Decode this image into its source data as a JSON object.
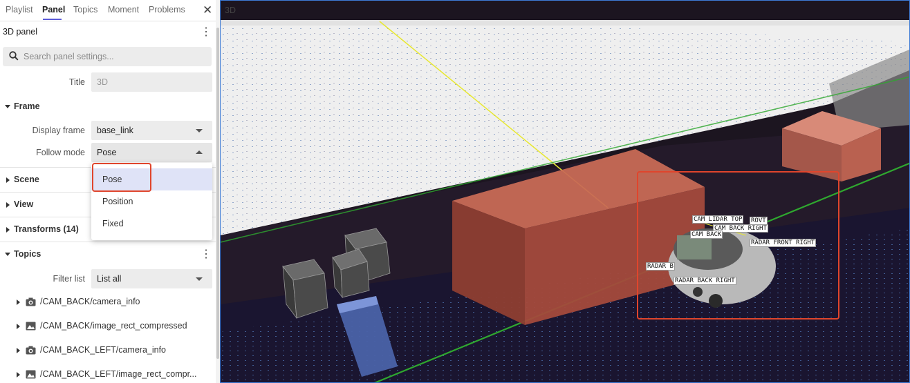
{
  "tabs": [
    {
      "label": "Playlist",
      "active": false
    },
    {
      "label": "Panel",
      "active": true
    },
    {
      "label": "Topics",
      "active": false
    },
    {
      "label": "Moment",
      "active": false
    },
    {
      "label": "Problems",
      "active": false
    }
  ],
  "close_glyph": "✕",
  "panel": {
    "name": "3D panel",
    "search_placeholder": "Search panel settings...",
    "title_label": "Title",
    "title_value": "3D"
  },
  "frame": {
    "section": "Frame",
    "display_label": "Display frame",
    "display_value": "base_link",
    "follow_label": "Follow mode",
    "follow_value": "Pose",
    "follow_options": [
      "Pose",
      "Position",
      "Fixed"
    ]
  },
  "sections": {
    "scene": "Scene",
    "view": "View",
    "transforms": "Transforms (14)",
    "topics": "Topics"
  },
  "topics": {
    "filter_label": "Filter list",
    "filter_value": "List all",
    "items": [
      {
        "name": "/CAM_BACK/camera_info",
        "icon": "camera-icon"
      },
      {
        "name": "/CAM_BACK/image_rect_compressed",
        "icon": "image-icon"
      },
      {
        "name": "/CAM_BACK_LEFT/camera_info",
        "icon": "camera-icon"
      },
      {
        "name": "/CAM_BACK_LEFT/image_rect_compr...",
        "icon": "image-icon"
      }
    ]
  },
  "viewport": {
    "title": "3D",
    "labels": [
      "CAM LIDAR TOP",
      "ROVT",
      "CAM BACK RIGHT",
      "CAM BACK",
      "RADAR FRONT RIGHT",
      "RADAR B",
      "RADAR BACK RIGHT"
    ]
  },
  "colors": {
    "accent": "#5a5ad8",
    "highlight": "#e0452c",
    "box_red": "#b8523f",
    "grid_green": "#2fa82f"
  }
}
